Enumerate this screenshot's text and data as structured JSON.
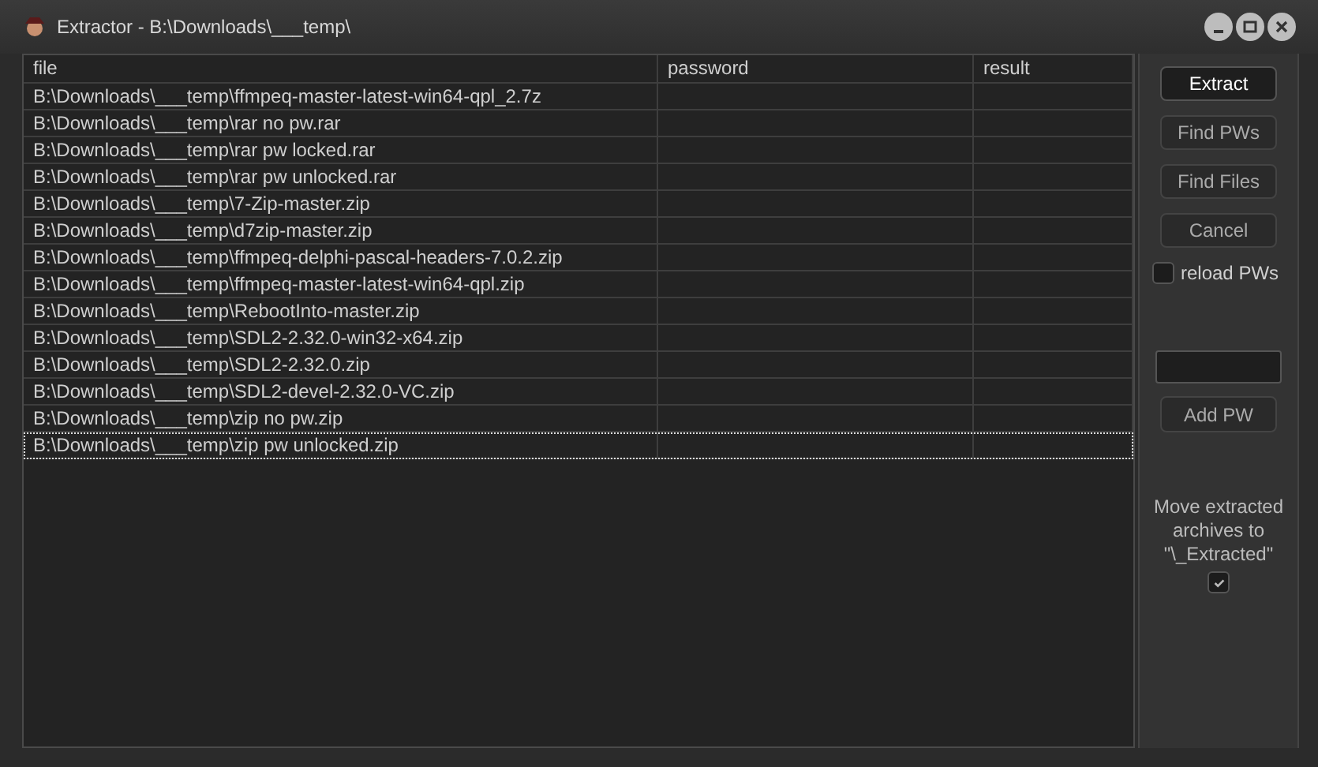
{
  "window": {
    "title": "Extractor - B:\\Downloads\\___temp\\"
  },
  "table": {
    "columns": [
      "file",
      "password",
      "result"
    ],
    "rows": [
      {
        "file": "B:\\Downloads\\___temp\\ffmpeq-master-latest-win64-qpl_2.7z",
        "focused": false
      },
      {
        "file": "B:\\Downloads\\___temp\\rar no pw.rar",
        "focused": false
      },
      {
        "file": "B:\\Downloads\\___temp\\rar pw locked.rar",
        "focused": false
      },
      {
        "file": "B:\\Downloads\\___temp\\rar pw unlocked.rar",
        "focused": false
      },
      {
        "file": "B:\\Downloads\\___temp\\7-Zip-master.zip",
        "focused": false
      },
      {
        "file": "B:\\Downloads\\___temp\\d7zip-master.zip",
        "focused": false
      },
      {
        "file": "B:\\Downloads\\___temp\\ffmpeq-delphi-pascal-headers-7.0.2.zip",
        "focused": false
      },
      {
        "file": "B:\\Downloads\\___temp\\ffmpeq-master-latest-win64-qpl.zip",
        "focused": false
      },
      {
        "file": "B:\\Downloads\\___temp\\RebootInto-master.zip",
        "focused": false
      },
      {
        "file": "B:\\Downloads\\___temp\\SDL2-2.32.0-win32-x64.zip",
        "focused": false
      },
      {
        "file": "B:\\Downloads\\___temp\\SDL2-2.32.0.zip",
        "focused": false
      },
      {
        "file": "B:\\Downloads\\___temp\\SDL2-devel-2.32.0-VC.zip",
        "focused": false
      },
      {
        "file": "B:\\Downloads\\___temp\\zip no pw.zip",
        "focused": false
      },
      {
        "file": "B:\\Downloads\\___temp\\zip pw unlocked.zip",
        "focused": true
      }
    ]
  },
  "buttons": [
    {
      "label": "Extract",
      "default": true
    },
    {
      "label": "Find PWs",
      "default": false
    },
    {
      "label": "Find Files",
      "default": false
    },
    {
      "label": "Cancel",
      "default": false
    }
  ],
  "reload_pws": {
    "label": "reload PWs",
    "checked": false
  },
  "add_pw": {
    "label": "Add PW"
  },
  "move_extracted": {
    "label": "Move extracted archives to \"\\_Extracted\"",
    "checked": true
  }
}
